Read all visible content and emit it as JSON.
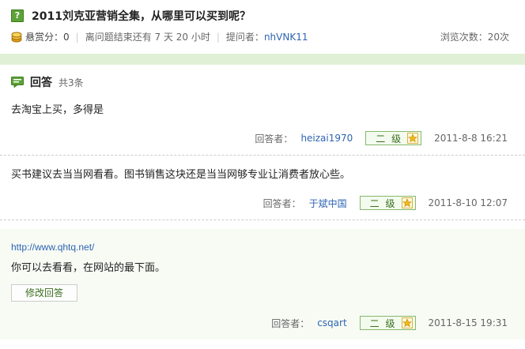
{
  "question": {
    "title": "2011刘克亚营销全集，从哪里可以买到呢？",
    "bounty_label": "悬赏分：",
    "bounty_value": "0",
    "time_left": "离问题结束还有 7 天 20 小时",
    "asker_label": "提问者：",
    "asker": "nhVNK11",
    "views": "浏览次数：20次"
  },
  "answers_header": {
    "title": "回答",
    "count": "共3条"
  },
  "answers": [
    {
      "text": "去淘宝上买，多得是",
      "by_label": "回答者：",
      "author": "heizai1970",
      "level": "二 级",
      "date": "2011-8-8 16:21"
    },
    {
      "text": "买书建议去当当网看看。图书销售这块还是当当网够专业让消费者放心些。",
      "by_label": "回答者：",
      "author": "于斌中国",
      "level": "二 级",
      "date": "2011-8-10 12:07"
    },
    {
      "link": "http://www.qhtq.net/",
      "text": "你可以去看看，在网站的最下面。",
      "edit_label": "修改回答",
      "by_label": "回答者：",
      "author": "csqart",
      "level": "二 级",
      "date": "2011-8-15 19:31"
    }
  ],
  "icons": {
    "question": "question-mark-icon",
    "coin": "coin-icon",
    "answer": "speech-bubble-icon",
    "star": "star-icon"
  }
}
